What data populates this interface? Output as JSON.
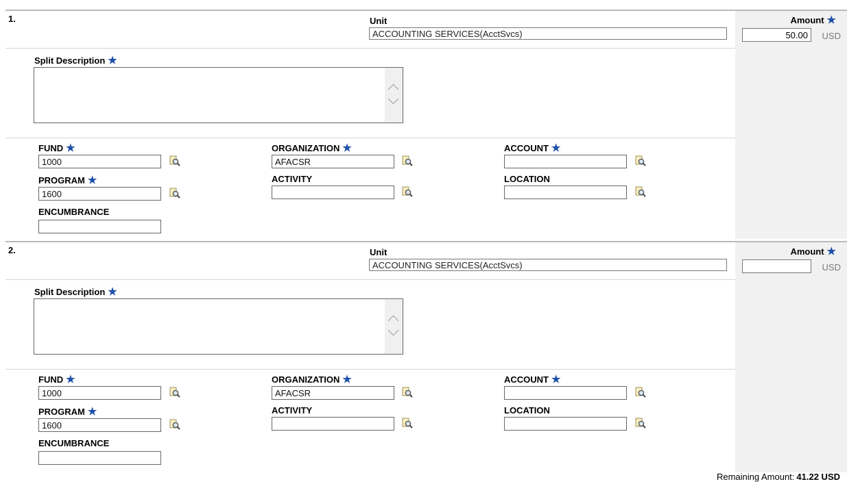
{
  "footer": {
    "remaining_label": "Remaining Amount:",
    "remaining_value": "41.22 USD"
  },
  "labels": {
    "unit": "Unit",
    "amount": "Amount",
    "required_mark": "★",
    "currency": "USD",
    "split_description": "Split Description",
    "fund": "FUND",
    "organization": "ORGANIZATION",
    "account": "ACCOUNT",
    "program": "PROGRAM",
    "activity": "ACTIVITY",
    "location": "LOCATION",
    "encumbrance": "ENCUMBRANCE"
  },
  "splits": [
    {
      "number": "1.",
      "unit": "ACCOUNTING SERVICES(AcctSvcs)",
      "amount": "50.00",
      "description": "",
      "fund": "1000",
      "organization": "AFACSR",
      "account": "",
      "program": "1600",
      "activity": "",
      "location": "",
      "encumbrance": ""
    },
    {
      "number": "2.",
      "unit": "ACCOUNTING SERVICES(AcctSvcs)",
      "amount": "",
      "description": "",
      "fund": "1000",
      "organization": "AFACSR",
      "account": "",
      "program": "1600",
      "activity": "",
      "location": "",
      "encumbrance": ""
    }
  ]
}
